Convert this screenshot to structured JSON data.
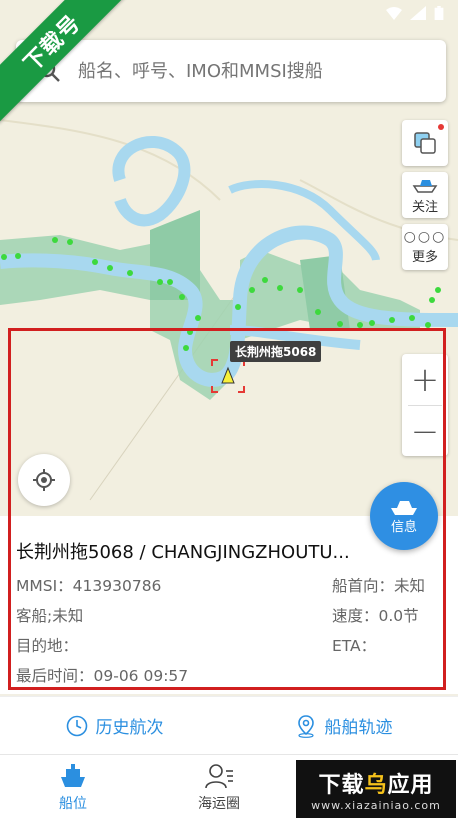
{
  "status_bar": {
    "icons": [
      "wifi-icon",
      "signal-icon",
      "battery-icon"
    ]
  },
  "ribbon": {
    "text": "下载号"
  },
  "search": {
    "placeholder": "船名、呼号、IMO和MMSI搜船"
  },
  "side_buttons": {
    "layers_icon": "layers-icon",
    "follow_label": "关注",
    "more_label": "更多"
  },
  "map": {
    "ship_label": "长荆州拖5068",
    "zoom_in": "+",
    "zoom_out": "−"
  },
  "info_button": {
    "label": "信息"
  },
  "ship": {
    "title": "长荆州拖5068 / CHANGJINGZHOUTU...",
    "mmsi": "MMSI：413930786",
    "heading": "船首向：未知",
    "type": "客船;未知",
    "speed": "速度：0.0节",
    "destination": "目的地：",
    "eta": "ETA：",
    "last_time": "最后时间：09-06 09:57"
  },
  "actions": {
    "history": "历史航次",
    "track": "船舶轨迹"
  },
  "tabs": [
    {
      "label": "船位",
      "icon": "ship-icon",
      "active": true
    },
    {
      "label": "海运圈",
      "icon": "people-icon",
      "active": false
    }
  ],
  "watermark": {
    "title_a": "下载",
    "title_b": "乌",
    "title_c": "应用",
    "url": "www.xiazainiao.com"
  },
  "colors": {
    "accent": "#2b8fe0",
    "highlight": "#d11f1f",
    "ribbon": "#1a9a43",
    "water": "#a8d8ef",
    "land_green": "#8fcba6"
  }
}
